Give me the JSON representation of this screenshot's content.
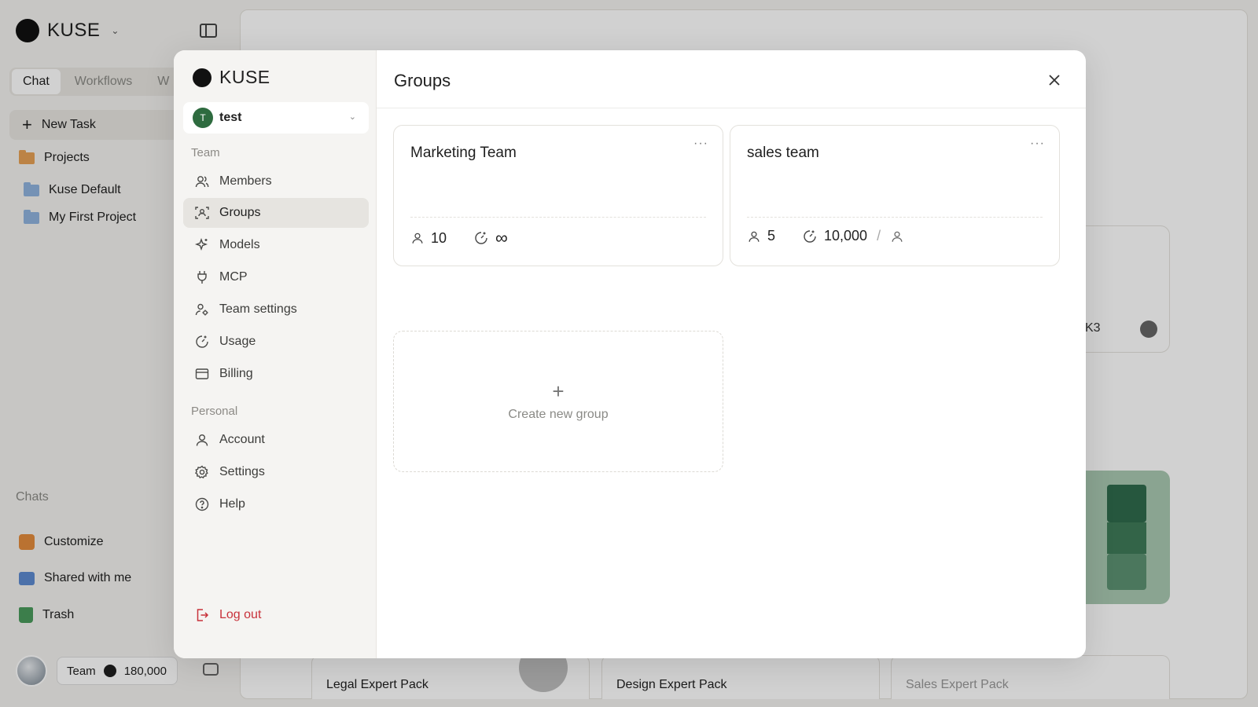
{
  "app": {
    "brand": "KUSE",
    "tabs": [
      "Chat",
      "Workflows",
      "W"
    ],
    "new_task": "New Task",
    "projects_label": "Projects",
    "projects": [
      "Kuse Default",
      "My First Project"
    ],
    "chats_label": "Chats",
    "bottom_items": [
      "Customize",
      "Shared with me",
      "Trash"
    ],
    "plan": "Team",
    "credits": "180,000"
  },
  "background": {
    "model_fragment": "K3",
    "expert_packs": [
      "Legal Expert Pack",
      "Design Expert Pack",
      "Sales Expert Pack"
    ]
  },
  "modal": {
    "brand": "KUSE",
    "team": {
      "initial": "T",
      "name": "test"
    },
    "team_section_label": "Team",
    "team_items": [
      {
        "label": "Members",
        "icon": "members-icon"
      },
      {
        "label": "Groups",
        "icon": "groups-icon",
        "active": true
      },
      {
        "label": "Models",
        "icon": "models-icon"
      },
      {
        "label": "MCP",
        "icon": "plug-icon"
      },
      {
        "label": "Team settings",
        "icon": "team-settings-icon"
      },
      {
        "label": "Usage",
        "icon": "usage-icon"
      },
      {
        "label": "Billing",
        "icon": "billing-icon"
      }
    ],
    "personal_section_label": "Personal",
    "personal_items": [
      {
        "label": "Account",
        "icon": "account-icon"
      },
      {
        "label": "Settings",
        "icon": "settings-icon"
      },
      {
        "label": "Help",
        "icon": "help-icon"
      }
    ],
    "logout_label": "Log out",
    "title": "Groups",
    "groups": [
      {
        "name": "Marketing Team",
        "members": "10",
        "quota": "∞"
      },
      {
        "name": "sales team",
        "members": "5",
        "quota": "10,000",
        "per_user": true
      }
    ],
    "create_label": "Create new group",
    "colors": {
      "accent_green": "#2e6b3f",
      "logout_red": "#c8323b"
    }
  }
}
